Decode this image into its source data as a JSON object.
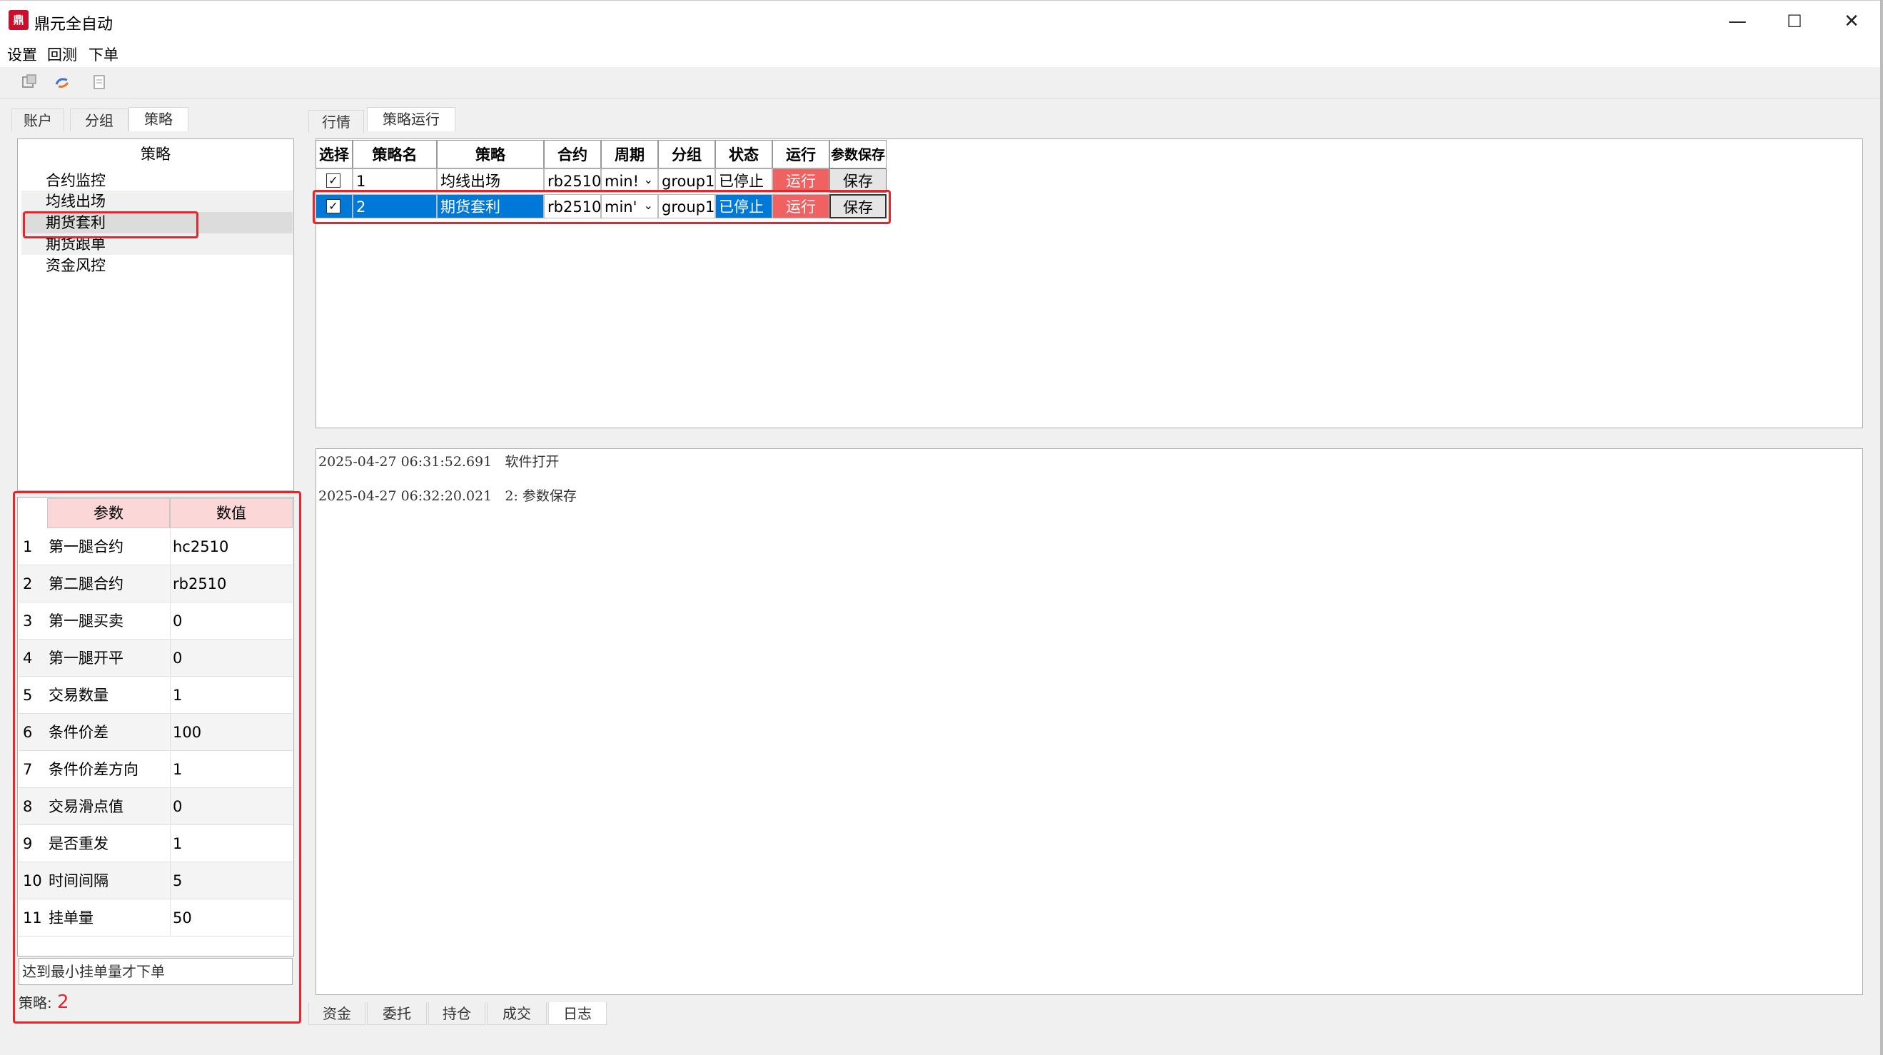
{
  "window": {
    "title": "鼎元全自动",
    "app_icon_text": "鼎",
    "minimize_glyph": "—",
    "maximize_glyph": "☐",
    "close_glyph": "✕"
  },
  "menu": {
    "items": [
      "设置",
      "回测",
      "下单"
    ]
  },
  "toolbar": {
    "icons": [
      "settings-icon",
      "refresh-icon",
      "document-icon"
    ]
  },
  "left_tabs": [
    "账户",
    "分组",
    "策略"
  ],
  "left_active_tab": "策略",
  "strategy_list": {
    "header": "策略",
    "items": [
      "合约监控",
      "均线出场",
      "期货套利",
      "期货跟单",
      "资金风控"
    ],
    "selected": "期货套利"
  },
  "params": {
    "headers": [
      "参数",
      "数值"
    ],
    "rows": [
      {
        "idx": "1",
        "name": "第一腿合约",
        "value": "hc2510"
      },
      {
        "idx": "2",
        "name": "第二腿合约",
        "value": "rb2510"
      },
      {
        "idx": "3",
        "name": "第一腿买卖",
        "value": "0"
      },
      {
        "idx": "4",
        "name": "第一腿开平",
        "value": "0"
      },
      {
        "idx": "5",
        "name": "交易数量",
        "value": "1"
      },
      {
        "idx": "6",
        "name": "条件价差",
        "value": "100"
      },
      {
        "idx": "7",
        "name": "条件价差方向",
        "value": "1"
      },
      {
        "idx": "8",
        "name": "交易滑点值",
        "value": "0"
      },
      {
        "idx": "9",
        "name": "是否重发",
        "value": "1"
      },
      {
        "idx": "10",
        "name": "时间间隔",
        "value": "5"
      },
      {
        "idx": "11",
        "name": "挂单量",
        "value": "50"
      }
    ],
    "description": "达到最小挂单量才下单",
    "strategy_label": "策略:",
    "strategy_id": "2"
  },
  "right_tabs": [
    "行情",
    "策略运行"
  ],
  "right_active_tab": "策略运行",
  "grid": {
    "headers": [
      "选择",
      "策略名",
      "策略",
      "合约",
      "周期",
      "分组",
      "状态",
      "运行",
      "参数保存"
    ],
    "rows": [
      {
        "checked": "✓",
        "name": "1",
        "strategy": "均线出场",
        "contract": "rb2510",
        "period": "min!",
        "group": "group1",
        "status": "已停止",
        "run": "运行",
        "save": "保存"
      },
      {
        "checked": "✓",
        "name": "2",
        "strategy": "期货套利",
        "contract": "rb2510",
        "period": "min'",
        "group": "group1",
        "status": "已停止",
        "run": "运行",
        "save": "保存"
      }
    ],
    "dropdown_glyph": "⌄"
  },
  "log": {
    "lines": [
      {
        "time": "2025-04-27 06:31:52.691",
        "text": "软件打开"
      },
      {
        "time": "2025-04-27 06:32:20.021",
        "text": "2: 参数保存"
      }
    ]
  },
  "bottom_tabs": [
    "资金",
    "委托",
    "持仓",
    "成交",
    "日志"
  ],
  "bottom_active_tab": "日志",
  "colors": {
    "accent": "#0078d7",
    "run_button": "#f06262",
    "highlight": "#e8252a",
    "param_header": "#fcd7d7"
  }
}
